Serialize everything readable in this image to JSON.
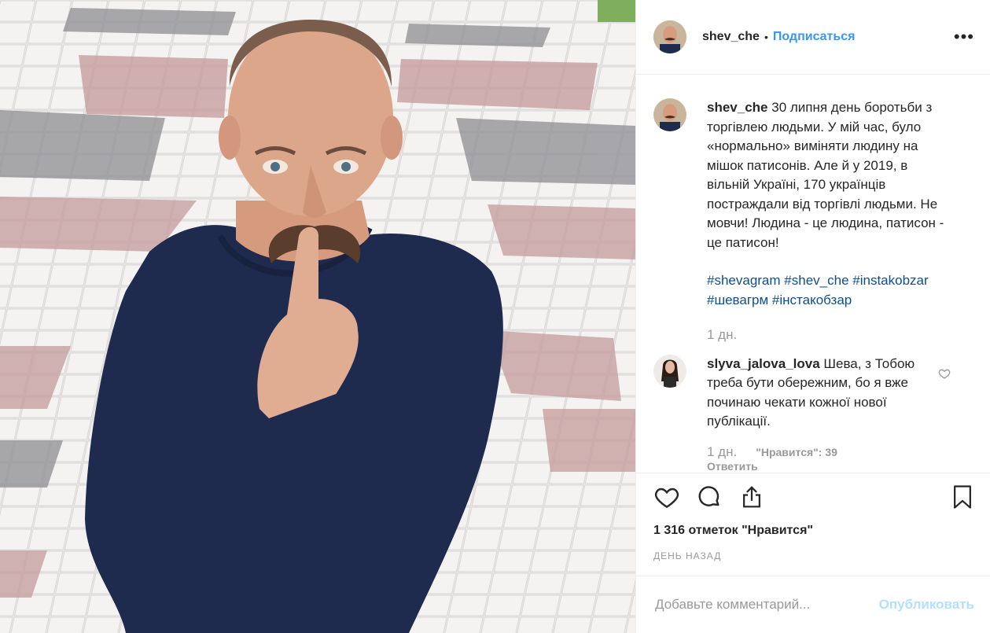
{
  "header": {
    "username": "shev_che",
    "separator": "•",
    "follow_label": "Подписаться",
    "more_label": "•••"
  },
  "caption": {
    "username": "shev_che",
    "text": "30 липня день боротьби з торгівлею людьми. У мій час, було «нормально» виміняти людину на мішок патисонів. Але й у 2019, в вільній Україні, 170 українців постраждали від торгівлі людьми. Не мовчи! Людина - це людина, патисон - це патисон!",
    "tags": [
      "#shevagram",
      "#shev_che",
      "#instakobzar",
      "#шевагрм",
      "#інстакобзар"
    ],
    "time": "1 дн."
  },
  "comment": {
    "username": "slyva_jalova_lova",
    "text": "Шева, з Тобою треба бути обережним, бо я вже починаю чекати кожної нової публікації.",
    "time": "1 дн.",
    "likes": "\"Нравится\": 39",
    "reply_label": "Ответить"
  },
  "post": {
    "likes_count": "1 316 отметок \"Нравится\"",
    "posted_ago": "ДЕНЬ НАЗАД"
  },
  "add_comment": {
    "placeholder": "Добавьте комментарий...",
    "publish_label": "Опубликовать"
  },
  "icons": {
    "like": "heart-icon",
    "comment": "comment-icon",
    "share": "share-icon",
    "save": "bookmark-icon",
    "more": "more-icon"
  },
  "colors": {
    "link": "#3897f0",
    "hashtag": "#0f4e8a",
    "muted": "#999999",
    "publish_disabled": "#b2dffc"
  }
}
